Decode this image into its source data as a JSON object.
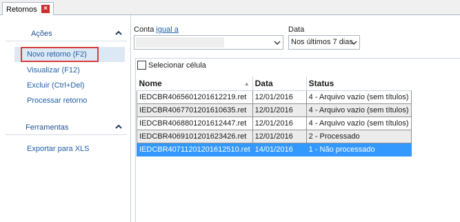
{
  "tab": {
    "label": "Retornos",
    "close": "×"
  },
  "sidebar": {
    "acoes": {
      "title": "Ações",
      "items": [
        {
          "label": "Novo retorno (F2)"
        },
        {
          "label": "Visualizar (F12)"
        },
        {
          "label": "Excluir (Ctrl+Del)"
        },
        {
          "label": "Processar retorno"
        }
      ]
    },
    "ferramentas": {
      "title": "Ferramentas",
      "items": [
        {
          "label": "Exportar para XLS"
        }
      ]
    }
  },
  "filters": {
    "conta_label": "Conta",
    "conta_operator": "igual a",
    "conta_value": "",
    "data_label": "Data",
    "data_value": "Nos últimos 7 dias"
  },
  "grid": {
    "select_cell_label": "Selecionar célula",
    "columns": [
      "Nome",
      "Data",
      "Status"
    ],
    "rows": [
      {
        "nome": "IEDCBR4065601201612219.ret",
        "data": "12/01/2016",
        "status": "4 - Arquivo vazio (sem títulos)"
      },
      {
        "nome": "IEDCBR4067701201610635.ret",
        "data": "12/01/2016",
        "status": "4 - Arquivo vazio (sem títulos)"
      },
      {
        "nome": "IEDCBR4068801201612447.ret",
        "data": "12/01/2016",
        "status": "4 - Arquivo vazio (sem títulos)"
      },
      {
        "nome": "IEDCBR4069101201623426.ret",
        "data": "12/01/2016",
        "status": "2 - Processado"
      },
      {
        "nome": "IEDCBR4071120120161251​0.ret",
        "data": "14/01/2016",
        "status": "1 - Não processado"
      }
    ],
    "selected_row": 4
  },
  "colors": {
    "link": "#1f5fa6",
    "selected_row": "#3399ff",
    "highlight_box": "#d63a3a",
    "close_button": "#c9302c"
  }
}
